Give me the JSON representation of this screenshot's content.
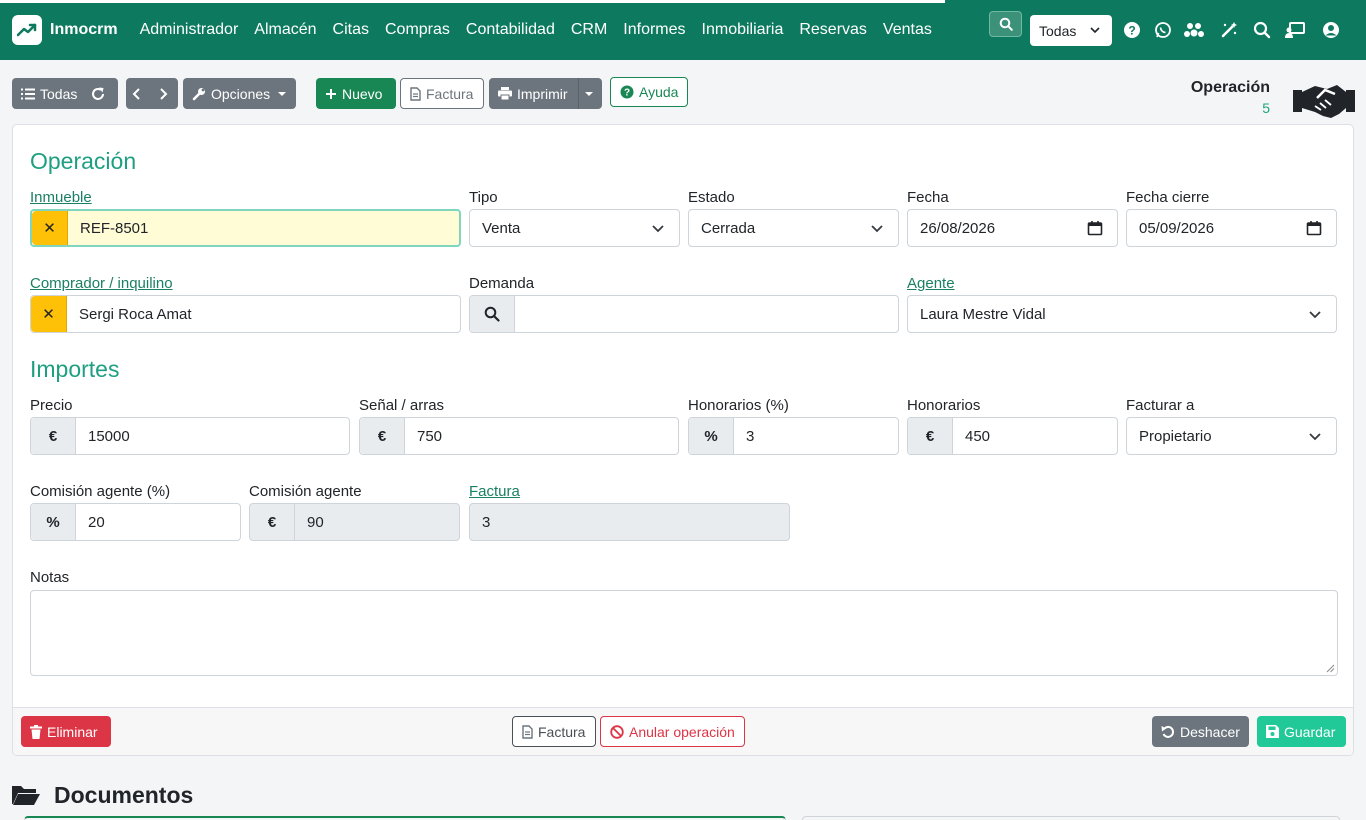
{
  "navbar": {
    "brand": "Inmocrm",
    "menu": [
      "Administrador",
      "Almacén",
      "Citas",
      "Compras",
      "Contabilidad",
      "CRM",
      "Informes",
      "Inmobiliaria",
      "Reservas",
      "Ventas"
    ],
    "select_value": "Todas",
    "icons": [
      "search-icon",
      "help-icon",
      "whatsapp-icon",
      "users-cog-icon",
      "magic-wand-icon",
      "search-icon",
      "chalkboard-user-icon",
      "user-circle-icon"
    ]
  },
  "toolbar": {
    "all_label": "Todas",
    "options_label": "Opciones",
    "new_label": "Nuevo",
    "invoice_label": "Factura",
    "print_label": "Imprimir",
    "help_label": "Ayuda",
    "record_title": "Operación",
    "record_number": "5"
  },
  "form": {
    "section_operation": "Operación",
    "property_label": "Inmueble",
    "property_value": "REF-8501",
    "type_label": "Tipo",
    "type_value": "Venta",
    "status_label": "Estado",
    "status_value": "Cerrada",
    "date_label": "Fecha",
    "date_value": "26/08/2026",
    "close_date_label": "Fecha cierre",
    "close_date_value": "05/09/2026",
    "buyer_label": "Comprador / inquilino",
    "buyer_value": "Sergi Roca Amat",
    "demand_label": "Demanda",
    "demand_value": "",
    "agent_label": "Agente",
    "agent_value": "Laura Mestre Vidal",
    "section_amounts": "Importes",
    "price_label": "Precio",
    "price_value": "15000",
    "deposit_label": "Señal / arras",
    "deposit_value": "750",
    "fees_pct_label": "Honorarios (%)",
    "fees_pct_value": "3",
    "fees_label": "Honorarios",
    "fees_value": "450",
    "bill_to_label": "Facturar a",
    "bill_to_value": "Propietario",
    "agent_comm_pct_label": "Comisión agente (%)",
    "agent_comm_pct_value": "20",
    "agent_comm_label": "Comisión agente",
    "agent_comm_value": "90",
    "invoice_label": "Factura",
    "invoice_value": "3",
    "notes_label": "Notas",
    "notes_value": "",
    "currency_symbol": "€",
    "percent_symbol": "%",
    "clear_symbol": "✕"
  },
  "footer": {
    "delete_label": "Eliminar",
    "invoice_label": "Factura",
    "cancel_label": "Anular operación",
    "undo_label": "Deshacer",
    "save_label": "Guardar"
  },
  "documents": {
    "title": "Documentos"
  },
  "colors": {
    "brand": "#0d7a5f",
    "accent": "#1f9f82",
    "primary_button": "#198754",
    "danger": "#dc3545",
    "save": "#20c997",
    "warning": "#ffc107"
  }
}
